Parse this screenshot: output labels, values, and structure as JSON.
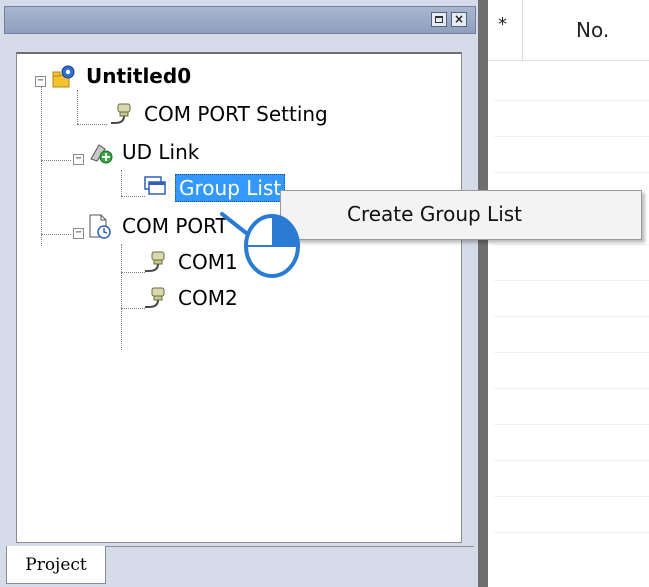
{
  "project_panel": {
    "tab_label": "Project",
    "tree": {
      "root": "Untitled0",
      "com_port_setting": "COM PORT Setting",
      "ud_link": "UD Link",
      "group_list": "Group List",
      "com_port": "COM PORT",
      "com1": "COM1",
      "com2": "COM2"
    }
  },
  "grid": {
    "columns": [
      "*",
      "No."
    ]
  },
  "context_menu": {
    "items": [
      "Create Group List"
    ]
  },
  "icons": {
    "restore": "restore-icon",
    "close": "close-icon",
    "project_root": "project-gear-icon",
    "com_port_setting": "connector-icon",
    "ud_link": "link-add-icon",
    "group_list": "group-list-icon",
    "com_port": "document-clock-icon",
    "com_item": "connector-icon"
  },
  "colors": {
    "selection": "#3399ff",
    "panel_bg": "#d6dbe9",
    "cursor_blue": "#2a7bd4"
  }
}
